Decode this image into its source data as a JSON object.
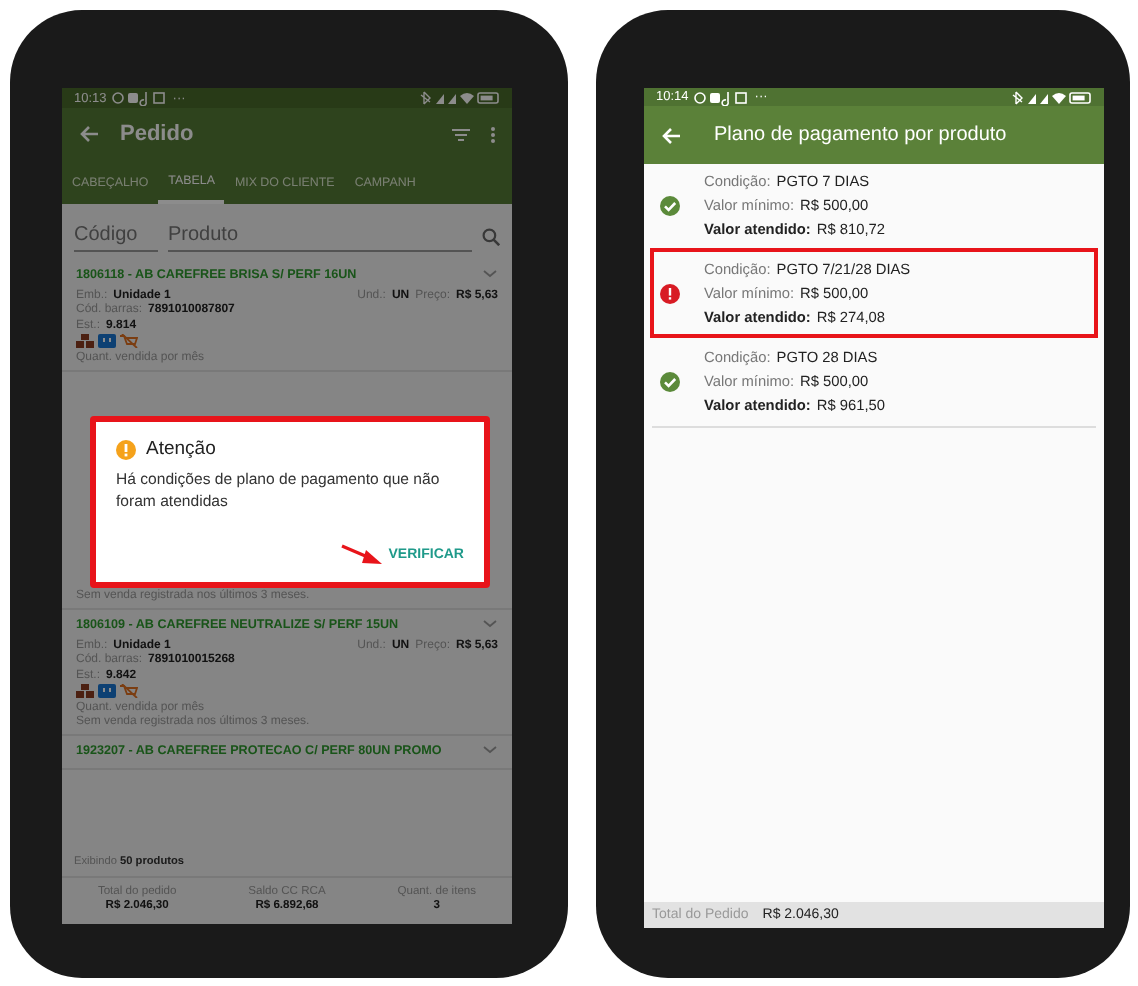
{
  "order_screen": {
    "status_bar": {
      "time": "10:13",
      "more": "···"
    },
    "app_bar": {
      "title": "Pedido"
    },
    "tabs": [
      {
        "label": "CABEÇALHO",
        "selected": false
      },
      {
        "label": "TABELA",
        "selected": true
      },
      {
        "label": "MIX DO CLIENTE",
        "selected": false
      },
      {
        "label": "CAMPANH",
        "selected": false
      }
    ],
    "search": {
      "code_placeholder": "Código",
      "product_placeholder": "Produto"
    },
    "products": [
      {
        "kind": "full",
        "title": "1806118 - AB CAREFREE BRISA S/ PERF 16UN",
        "emb_label": "Emb.:",
        "emb": "Unidade 1",
        "und_label": "Und.:",
        "und": "UN",
        "price_label": "Preço:",
        "price": "R$ 5,63",
        "barcode_label": "Cód. barras:",
        "barcode": "7891010087807",
        "stock_label": "Est.:",
        "stock": "9.814",
        "sales_label": "Quant. vendida por mês"
      },
      {
        "kind": "covered",
        "note": "Sem venda registrada nos últimos 3 meses."
      },
      {
        "kind": "full",
        "title": "1806109 - AB CAREFREE NEUTRALIZE S/ PERF 15UN",
        "emb_label": "Emb.:",
        "emb": "Unidade 1",
        "und_label": "Und.:",
        "und": "UN",
        "price_label": "Preço:",
        "price": "R$ 5,63",
        "barcode_label": "Cód. barras:",
        "barcode": "7891010015268",
        "stock_label": "Est.:",
        "stock": "9.842",
        "sales_label": "Quant. vendida por mês",
        "note": "Sem venda registrada nos últimos 3 meses."
      },
      {
        "kind": "title",
        "title": "1923207 - AB CAREFREE PROTECAO C/ PERF 80UN PROMO"
      }
    ],
    "showing": "Exibindo **50 produtos**",
    "totals": [
      {
        "label": "Total do pedido",
        "value": "R$ 2.046,30"
      },
      {
        "label": "Saldo CC RCA",
        "value": "R$ 6.892,68"
      },
      {
        "label": "Quant. de itens",
        "value": "3"
      }
    ],
    "dialog": {
      "title": "Atenção",
      "message": "Há condições de plano de pagamento que não foram atendidas",
      "action": "VERIFICAR"
    }
  },
  "payment_screen": {
    "status_bar": {
      "time": "10:14",
      "more": "···"
    },
    "app_bar": {
      "title": "Plano de pagamento por produto"
    },
    "conditions": [
      {
        "kind": "met",
        "highlighted": false,
        "condition_label": "Condição:",
        "condition": "PGTO 7 DIAS",
        "minimum_label": "Valor mínimo:",
        "minimum": "R$ 500,00",
        "met_label": "Valor atendido:",
        "met": "R$ 810,72"
      },
      {
        "kind": "unmet",
        "highlighted": true,
        "condition_label": "Condição:",
        "condition": "PGTO 7/21/28 DIAS",
        "minimum_label": "Valor mínimo:",
        "minimum": "R$ 500,00",
        "met_label": "Valor atendido:",
        "met": "R$ 274,08"
      },
      {
        "kind": "met",
        "highlighted": false,
        "condition_label": "Condição:",
        "condition": "PGTO 28 DIAS",
        "minimum_label": "Valor mínimo:",
        "minimum": "R$ 500,00",
        "met_label": "Valor atendido:",
        "met": "R$ 961,50"
      }
    ],
    "footer": {
      "label": "Total do Pedido",
      "value": "R$ 2.046,30"
    }
  }
}
